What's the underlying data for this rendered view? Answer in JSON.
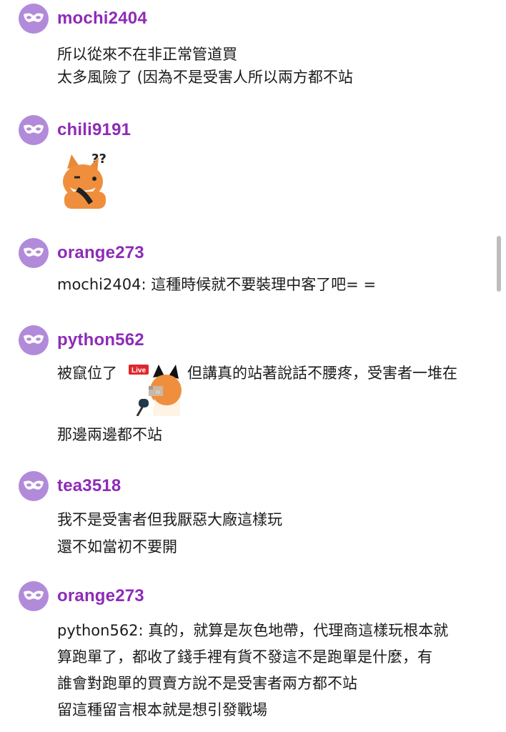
{
  "messages": [
    {
      "username": "mochi2404",
      "lines": [
        "所以從來不在非正常管道買",
        "太多風險了 (因為不是受害人所以兩方都不站"
      ]
    },
    {
      "username": "chili9191",
      "sticker": "fox-confused-sticker"
    },
    {
      "username": "orange273",
      "lines": [
        "mochi2404: 這種時候就不要裝理中客了吧= ="
      ]
    },
    {
      "username": "python562",
      "inline_before": "被竄位了",
      "inline_after": "但講真的站著說話不腰疼，受害者一堆在",
      "sticker_badge": "Live",
      "lines": [
        "那邊兩邊都不站"
      ]
    },
    {
      "username": "tea3518",
      "lines": [
        "我不是受害者但我厭惡大廠這樣玩",
        "還不如當初不要開"
      ]
    },
    {
      "username": "orange273",
      "lines": [
        "python562: 真的，就算是灰色地帶，代理商這樣玩根本就",
        "算跑單了，都收了錢手裡有貨不發這不是跑單是什麼，有",
        "誰會對跑單的買賣方說不是受害者兩方都不站",
        "留這種留言根本就是想引發戰場"
      ]
    }
  ],
  "colors": {
    "avatar": "#b18bd9",
    "username": "#8e2bb8",
    "text": "#1b1b1b"
  },
  "icons": {
    "avatar": "masquerade-mask-icon"
  }
}
